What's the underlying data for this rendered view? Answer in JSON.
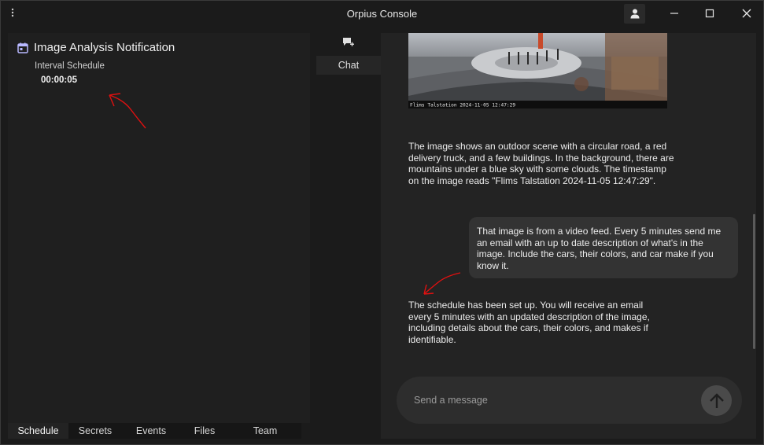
{
  "window": {
    "title": "Orpius Console"
  },
  "colors": {
    "background": "#1b1b1b",
    "panel": "#1f1f1f",
    "chat_panel": "#232323",
    "user_bubble": "#333333",
    "annotation_red": "#e01010"
  },
  "notification": {
    "icon": "calendar-icon",
    "title": "Image Analysis Notification",
    "interval_label": "Interval Schedule",
    "interval_value": "00:00:05"
  },
  "bottom_tabs": [
    "Schedule",
    "Secrets",
    "Events",
    "Files",
    "Team"
  ],
  "side_nav": {
    "chat_label": "Chat"
  },
  "image": {
    "timestamp_overlay": "Flims Talstation 2024-11-05 12:47:29"
  },
  "messages": {
    "assistant_1": "The image shows an outdoor scene with a circular road, a red delivery truck, and a few buildings. In the background, there are mountains under a blue sky with some clouds. The timestamp on the image reads \"Flims Talstation 2024-11-05 12:47:29\".",
    "user_1": "That image is from a video feed. Every 5 minutes send me an email with an up to date description of what's in the image. Include the cars, their colors, and car make if you know it.",
    "assistant_2": "The schedule has been set up. You will receive an email every 5 minutes with an updated description of the image, including details about the cars, their colors, and makes if identifiable."
  },
  "composer": {
    "placeholder": "Send a message"
  }
}
